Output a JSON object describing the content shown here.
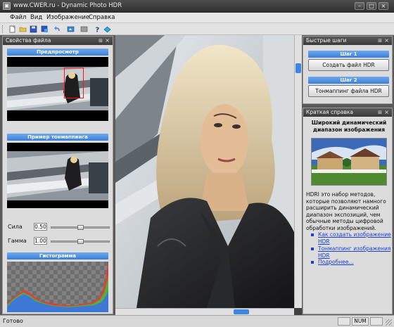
{
  "window": {
    "title": "www.CWER.ru - Dynamic Photo HDR",
    "app_icon": "app-icon",
    "buttons": [
      "minimize",
      "maximize",
      "close"
    ]
  },
  "menu": [
    {
      "label": "Файл"
    },
    {
      "label": "Вид"
    },
    {
      "label": "Изображение"
    },
    {
      "label": "Справка"
    }
  ],
  "toolbar": {
    "icons": [
      "new-icon",
      "open-icon",
      "save-icon",
      "save-as-icon",
      "undo-icon",
      "import-icon",
      "export-icon",
      "help-icon",
      "hdr-icon"
    ]
  },
  "file_panel": {
    "title": "Свойства файла",
    "preview_label": "Предпросмотр",
    "tonemap_label": "Пример тонмаппинга",
    "strength_label": "Сила",
    "strength_value": "0.50",
    "strength_level": 0.5,
    "gamma_label": "Гамма",
    "gamma_value": "1.00",
    "gamma_level": 0.5,
    "histogram_label": "Гистограмма"
  },
  "quick_steps": {
    "title": "Быстрые шаги",
    "step1_label": "Шаг 1",
    "step1_button": "Создать файл HDR",
    "step2_label": "Шаг 2",
    "step2_button": "Тонмаппинг файла HDR"
  },
  "help_panel": {
    "title": "Краткая справка",
    "heading": "Широкий динамический диапазон изображения",
    "body": "HDRI это набор методов, которые позволяют намного расширить динамический диапазон экспозиций, чем обычные методы цифровой обработки изображений.",
    "links": [
      "Как создать изображение HDR",
      "Тонмаппинг изображения HDR",
      "Подробнее..."
    ]
  },
  "status": {
    "ready": "Готово",
    "num": "NUM"
  },
  "colors": {
    "accent_blue": "#3b7fd6",
    "link_blue": "#1b3fd0",
    "panel_bg": "#dcdcdc",
    "titlebar": "#3a3a3a"
  }
}
